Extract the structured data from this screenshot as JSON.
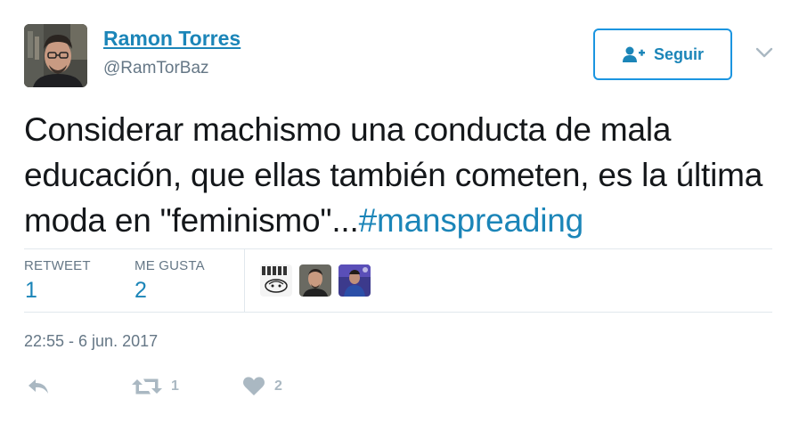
{
  "user": {
    "name": "Ramon Torres",
    "handle": "@RamTorBaz",
    "avatar_icon": "profile-photo"
  },
  "follow_button": {
    "label": "Seguir",
    "icon": "add-user-icon"
  },
  "tweet": {
    "text": "Considerar machismo una conducta de mala educación, que ellas también cometen, es la última moda en \"feminismo\"...",
    "hashtag": "#manspreading"
  },
  "stats": {
    "retweets_label": "RETWEET",
    "retweets_value": "1",
    "likes_label": "ME GUSTA",
    "likes_value": "2"
  },
  "liked_by": [
    "liker-avatar-1",
    "liker-avatar-2",
    "liker-avatar-3"
  ],
  "timestamp": "22:55 - 6 jun. 2017",
  "actions": {
    "reply_icon": "reply-icon",
    "retweet_icon": "retweet-icon",
    "retweet_count": "1",
    "like_icon": "heart-icon",
    "like_count": "2"
  },
  "colors": {
    "link": "#1b85b8",
    "accent": "#1b95e0",
    "muted": "#657786",
    "action_gray": "#aab8c2",
    "divider": "#e1e8ed"
  }
}
